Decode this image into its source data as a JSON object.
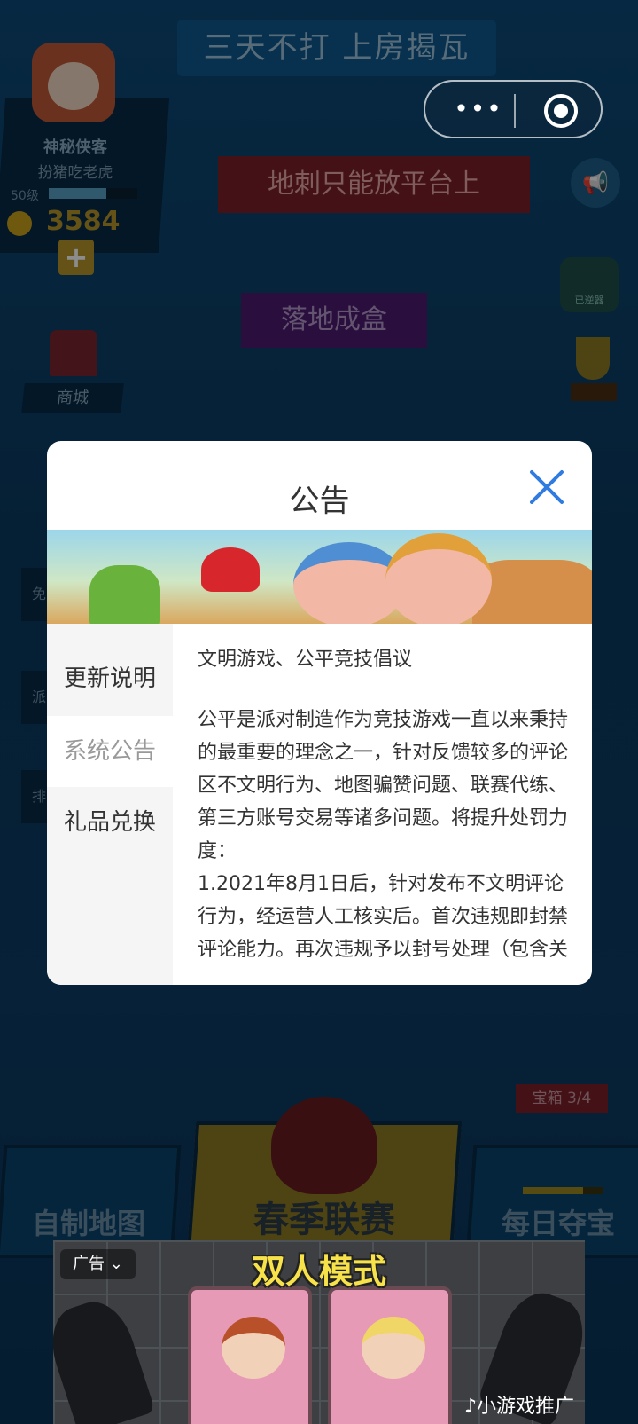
{
  "game": {
    "top_banner": "三天不打 上房揭瓦",
    "player": {
      "name": "神秘侠客",
      "title": "扮猪吃老虎",
      "level": "50级",
      "level_progress": 0.65,
      "coins": "3584",
      "add_label": "+"
    },
    "bubbles": {
      "red": "地刺只能放平台上",
      "purple": "落地成盒"
    },
    "right_badge": "已逆器",
    "shop_label": "商城",
    "side_tabs": [
      "免",
      "派",
      "排"
    ],
    "bottom": {
      "left_label": "自制地图",
      "center_label": "春季联赛",
      "right_label": "每日夺宝",
      "chest_tag": "宝箱 3/4",
      "chest_progress": 0.75
    }
  },
  "capsule": {
    "more_icon": "more-dots-icon",
    "close_icon": "target-close-icon"
  },
  "modal": {
    "title": "公告",
    "close_icon": "close-x-icon",
    "accent_color": "#2f7be0",
    "tabs": [
      {
        "label": "更新说明",
        "active": false
      },
      {
        "label": "系统公告",
        "active": true
      },
      {
        "label": "礼品兑换",
        "active": false
      }
    ],
    "heading": "文明游戏、公平竞技倡议",
    "body": "公平是派对制造作为竞技游戏一直以来秉持的最重要的理念之一，针对反馈较多的评论区不文明行为、地图骗赞问题、联赛代练、第三方账号交易等诸多问题。将提升处罚力度：\n1.2021年8月1日后，针对发布不文明评论行为，经运营人工核实后。首次违规即封禁评论能力。再次违规予以封号处理（包含关联小号，并封号）"
  },
  "ad": {
    "label": "广告",
    "title": "双人模式",
    "footer": "小游戏推广"
  }
}
